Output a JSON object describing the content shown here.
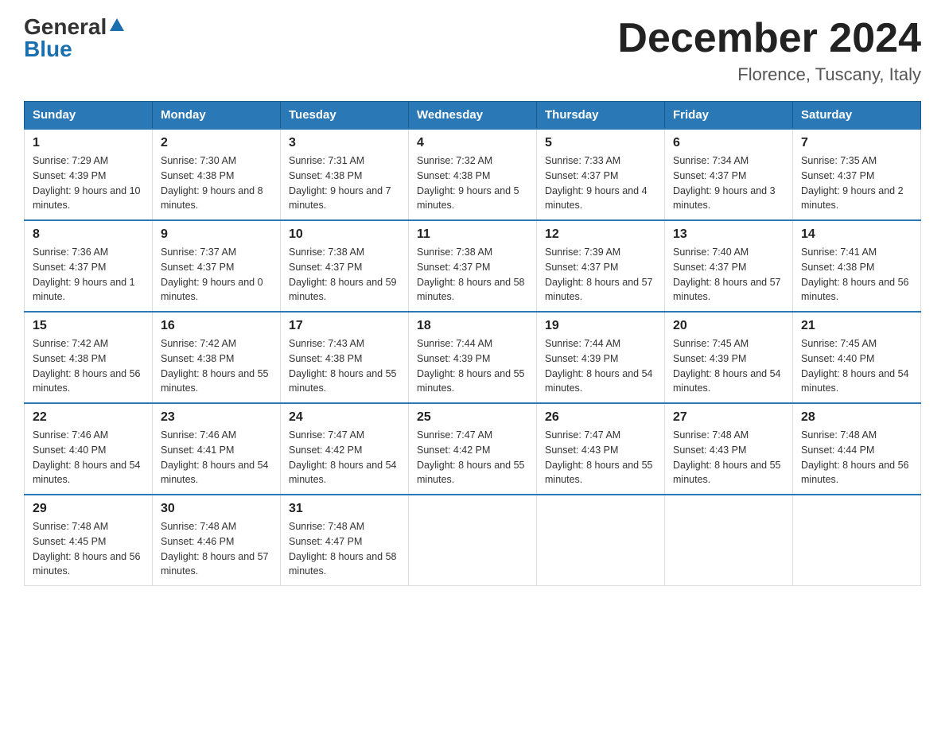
{
  "header": {
    "logo_general": "General",
    "logo_blue": "Blue",
    "title": "December 2024",
    "subtitle": "Florence, Tuscany, Italy"
  },
  "days_of_week": [
    "Sunday",
    "Monday",
    "Tuesday",
    "Wednesday",
    "Thursday",
    "Friday",
    "Saturday"
  ],
  "weeks": [
    [
      {
        "day": "1",
        "sunrise": "7:29 AM",
        "sunset": "4:39 PM",
        "daylight": "9 hours and 10 minutes."
      },
      {
        "day": "2",
        "sunrise": "7:30 AM",
        "sunset": "4:38 PM",
        "daylight": "9 hours and 8 minutes."
      },
      {
        "day": "3",
        "sunrise": "7:31 AM",
        "sunset": "4:38 PM",
        "daylight": "9 hours and 7 minutes."
      },
      {
        "day": "4",
        "sunrise": "7:32 AM",
        "sunset": "4:38 PM",
        "daylight": "9 hours and 5 minutes."
      },
      {
        "day": "5",
        "sunrise": "7:33 AM",
        "sunset": "4:37 PM",
        "daylight": "9 hours and 4 minutes."
      },
      {
        "day": "6",
        "sunrise": "7:34 AM",
        "sunset": "4:37 PM",
        "daylight": "9 hours and 3 minutes."
      },
      {
        "day": "7",
        "sunrise": "7:35 AM",
        "sunset": "4:37 PM",
        "daylight": "9 hours and 2 minutes."
      }
    ],
    [
      {
        "day": "8",
        "sunrise": "7:36 AM",
        "sunset": "4:37 PM",
        "daylight": "9 hours and 1 minute."
      },
      {
        "day": "9",
        "sunrise": "7:37 AM",
        "sunset": "4:37 PM",
        "daylight": "9 hours and 0 minutes."
      },
      {
        "day": "10",
        "sunrise": "7:38 AM",
        "sunset": "4:37 PM",
        "daylight": "8 hours and 59 minutes."
      },
      {
        "day": "11",
        "sunrise": "7:38 AM",
        "sunset": "4:37 PM",
        "daylight": "8 hours and 58 minutes."
      },
      {
        "day": "12",
        "sunrise": "7:39 AM",
        "sunset": "4:37 PM",
        "daylight": "8 hours and 57 minutes."
      },
      {
        "day": "13",
        "sunrise": "7:40 AM",
        "sunset": "4:37 PM",
        "daylight": "8 hours and 57 minutes."
      },
      {
        "day": "14",
        "sunrise": "7:41 AM",
        "sunset": "4:38 PM",
        "daylight": "8 hours and 56 minutes."
      }
    ],
    [
      {
        "day": "15",
        "sunrise": "7:42 AM",
        "sunset": "4:38 PM",
        "daylight": "8 hours and 56 minutes."
      },
      {
        "day": "16",
        "sunrise": "7:42 AM",
        "sunset": "4:38 PM",
        "daylight": "8 hours and 55 minutes."
      },
      {
        "day": "17",
        "sunrise": "7:43 AM",
        "sunset": "4:38 PM",
        "daylight": "8 hours and 55 minutes."
      },
      {
        "day": "18",
        "sunrise": "7:44 AM",
        "sunset": "4:39 PM",
        "daylight": "8 hours and 55 minutes."
      },
      {
        "day": "19",
        "sunrise": "7:44 AM",
        "sunset": "4:39 PM",
        "daylight": "8 hours and 54 minutes."
      },
      {
        "day": "20",
        "sunrise": "7:45 AM",
        "sunset": "4:39 PM",
        "daylight": "8 hours and 54 minutes."
      },
      {
        "day": "21",
        "sunrise": "7:45 AM",
        "sunset": "4:40 PM",
        "daylight": "8 hours and 54 minutes."
      }
    ],
    [
      {
        "day": "22",
        "sunrise": "7:46 AM",
        "sunset": "4:40 PM",
        "daylight": "8 hours and 54 minutes."
      },
      {
        "day": "23",
        "sunrise": "7:46 AM",
        "sunset": "4:41 PM",
        "daylight": "8 hours and 54 minutes."
      },
      {
        "day": "24",
        "sunrise": "7:47 AM",
        "sunset": "4:42 PM",
        "daylight": "8 hours and 54 minutes."
      },
      {
        "day": "25",
        "sunrise": "7:47 AM",
        "sunset": "4:42 PM",
        "daylight": "8 hours and 55 minutes."
      },
      {
        "day": "26",
        "sunrise": "7:47 AM",
        "sunset": "4:43 PM",
        "daylight": "8 hours and 55 minutes."
      },
      {
        "day": "27",
        "sunrise": "7:48 AM",
        "sunset": "4:43 PM",
        "daylight": "8 hours and 55 minutes."
      },
      {
        "day": "28",
        "sunrise": "7:48 AM",
        "sunset": "4:44 PM",
        "daylight": "8 hours and 56 minutes."
      }
    ],
    [
      {
        "day": "29",
        "sunrise": "7:48 AM",
        "sunset": "4:45 PM",
        "daylight": "8 hours and 56 minutes."
      },
      {
        "day": "30",
        "sunrise": "7:48 AM",
        "sunset": "4:46 PM",
        "daylight": "8 hours and 57 minutes."
      },
      {
        "day": "31",
        "sunrise": "7:48 AM",
        "sunset": "4:47 PM",
        "daylight": "8 hours and 58 minutes."
      },
      null,
      null,
      null,
      null
    ]
  ],
  "labels": {
    "sunrise": "Sunrise:",
    "sunset": "Sunset:",
    "daylight": "Daylight:"
  }
}
